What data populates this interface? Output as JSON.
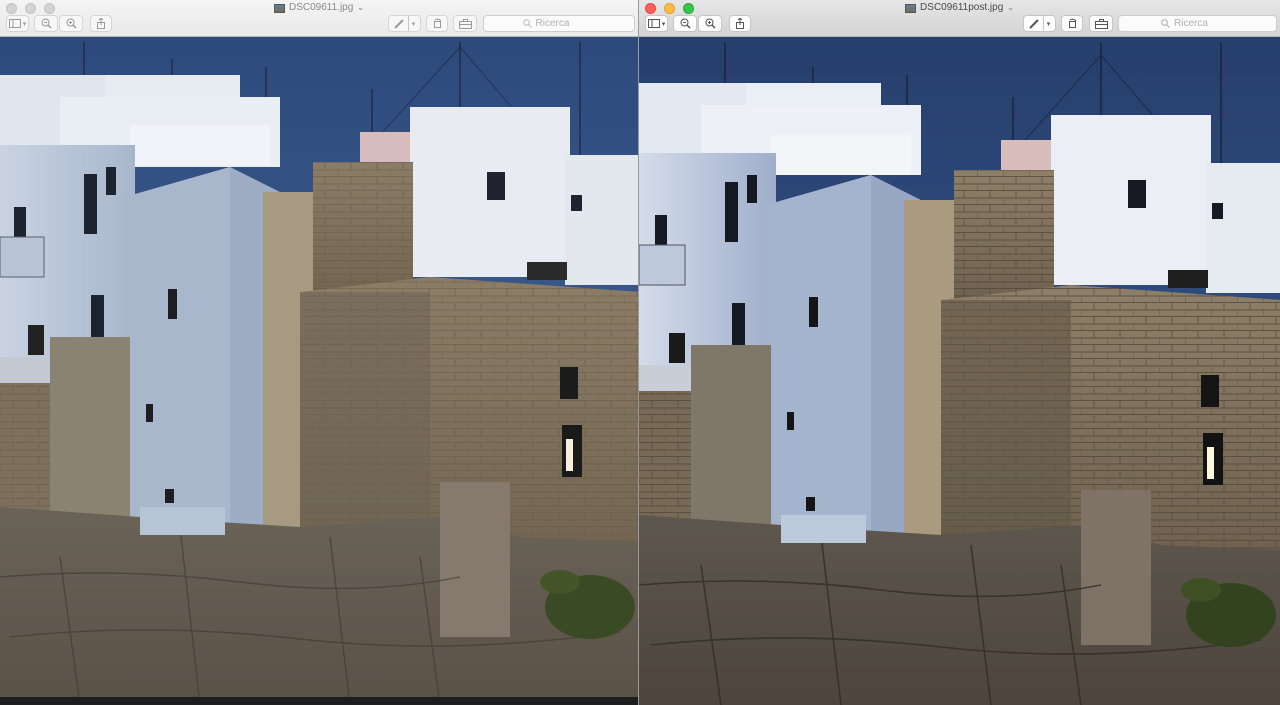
{
  "left_window": {
    "title": "DSC09611.jpg",
    "search_placeholder": "Ricerca",
    "active": false
  },
  "right_window": {
    "title": "DSC09611post.jpg",
    "search_placeholder": "Ricerca",
    "active": true
  },
  "toolbar_icons": [
    "sidebar-icon",
    "chevron-down-icon",
    "zoom-out-icon",
    "zoom-in-icon",
    "share-icon",
    "markup-pen-icon",
    "chevron-down-icon",
    "rotate-icon",
    "toolbox-icon",
    "search-icon"
  ],
  "colors": {
    "sky": "#3c5a8c",
    "white_wall": "#dfe4ec",
    "stone": "#8a7c66",
    "cliff": "#6b6258"
  }
}
